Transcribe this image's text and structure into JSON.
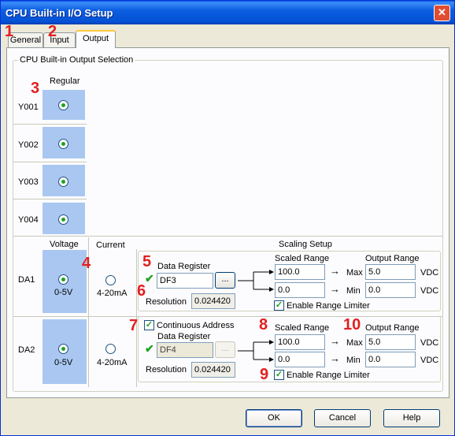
{
  "window": {
    "title": "CPU Built-in I/O Setup"
  },
  "tabs": [
    {
      "label": "General"
    },
    {
      "label": "Input"
    },
    {
      "label": "Output"
    }
  ],
  "callouts": [
    "1",
    "2",
    "3",
    "4",
    "5",
    "6",
    "7",
    "8",
    "9",
    "10"
  ],
  "output_group": {
    "title": "CPU Built-in Output Selection",
    "regular_header": "Regular",
    "rows": [
      {
        "label": "Y001"
      },
      {
        "label": "Y002"
      },
      {
        "label": "Y003"
      },
      {
        "label": "Y004"
      }
    ]
  },
  "analog": {
    "voltage_header": "Voltage",
    "current_header": "Current",
    "scaling_header": "Scaling Setup",
    "da1": {
      "label": "DA1",
      "voltage_text": "0-5V",
      "current_text": "4-20mA",
      "data_register_label": "Data Register",
      "data_register": "DF3",
      "browse_label": "...",
      "resolution_label": "Resolution",
      "resolution": "0.024420",
      "scaled_range_label": "Scaled Range",
      "output_range_label": "Output Range",
      "scaled_max": "100.0",
      "scaled_min": "0.0",
      "max_label": "Max",
      "min_label": "Min",
      "output_max": "5.0",
      "output_min": "0.0",
      "unit": "VDC",
      "range_limiter_label": "Enable Range Limiter"
    },
    "da2": {
      "label": "DA2",
      "voltage_text": "0-5V",
      "current_text": "4-20mA",
      "continuous_label": "Continuous Address",
      "data_register_label": "Data Register",
      "data_register": "DF4",
      "browse_label": "...",
      "resolution_label": "Resolution",
      "resolution": "0.024420",
      "scaled_range_label": "Scaled Range",
      "output_range_label": "Output Range",
      "scaled_max": "100.0",
      "scaled_min": "0.0",
      "max_label": "Max",
      "min_label": "Min",
      "output_max": "5.0",
      "output_min": "0.0",
      "unit": "VDC",
      "range_limiter_label": "Enable Range Limiter"
    }
  },
  "buttons": {
    "ok": "OK",
    "cancel": "Cancel",
    "help": "Help"
  },
  "icons": {
    "check_mark": "✔",
    "arrow": "→"
  }
}
